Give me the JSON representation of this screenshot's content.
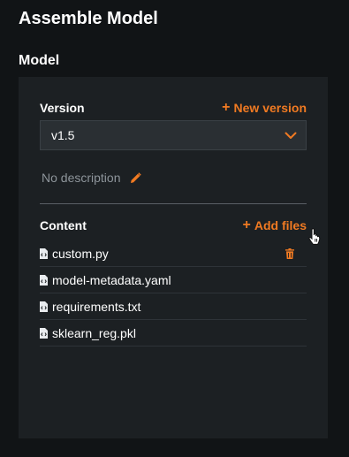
{
  "header": {
    "title": "Assemble Model"
  },
  "model": {
    "section_title": "Model",
    "version_label": "Version",
    "new_version_label": "New version",
    "selected_version": "v1.5",
    "description": "No description",
    "content_label": "Content",
    "add_files_label": "Add files",
    "files": [
      {
        "name": "custom.py",
        "deletable": true
      },
      {
        "name": "model-metadata.yaml",
        "deletable": false
      },
      {
        "name": "requirements.txt",
        "deletable": false
      },
      {
        "name": "sklearn_reg.pkl",
        "deletable": false
      }
    ]
  },
  "colors": {
    "accent": "#f07a22",
    "background": "#111416",
    "panel": "#1c2023",
    "select_bg": "#2a2f33",
    "muted_text": "#8d949a"
  },
  "icons": {
    "plus": "plus-icon",
    "chevron": "chevron-down-icon",
    "edit": "pencil-icon",
    "file": "file-code-icon",
    "delete": "trash-icon",
    "cursor": "hand-pointer-icon"
  }
}
